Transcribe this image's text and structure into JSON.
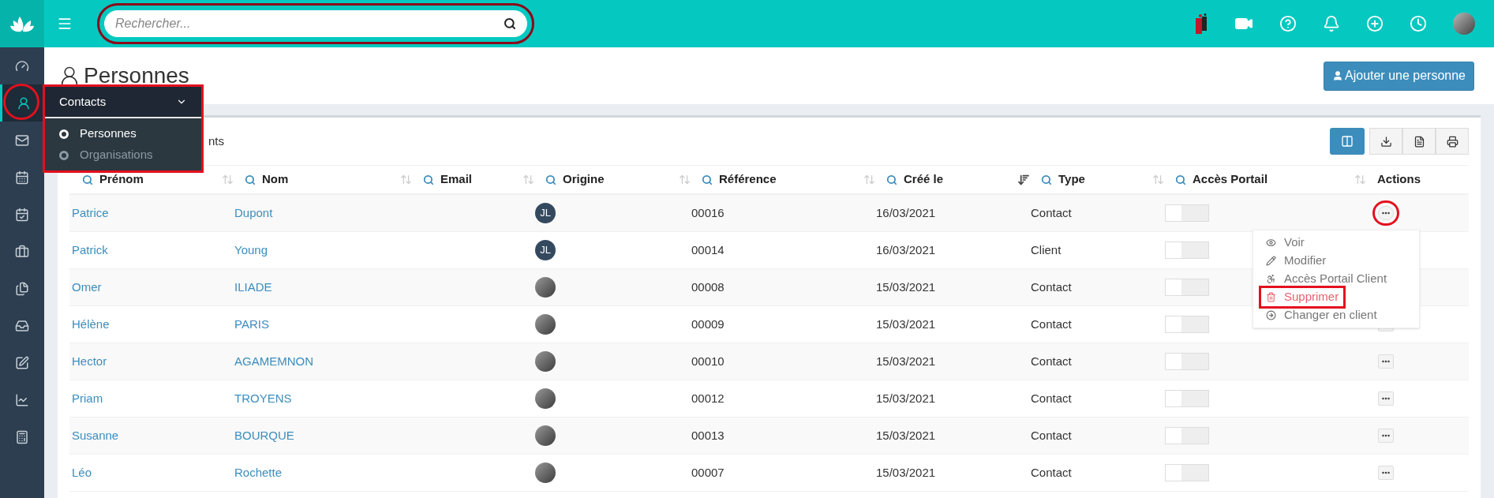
{
  "topbar": {
    "search": {
      "placeholder": "Rechercher..."
    }
  },
  "sidebar": {
    "items": [
      {
        "kind": "dashboard",
        "selected": false
      },
      {
        "kind": "contacts",
        "selected": true
      },
      {
        "kind": "mail",
        "selected": false
      },
      {
        "kind": "calendar",
        "selected": false
      },
      {
        "kind": "tasks",
        "selected": false
      },
      {
        "kind": "briefcase",
        "selected": false
      },
      {
        "kind": "documents",
        "selected": false
      },
      {
        "kind": "tray",
        "selected": false
      },
      {
        "kind": "edit",
        "selected": false
      },
      {
        "kind": "chart",
        "selected": false
      },
      {
        "kind": "calculator",
        "selected": false
      }
    ]
  },
  "flyout": {
    "title": "Contacts",
    "items": [
      {
        "label": "Personnes",
        "selected": true
      },
      {
        "label": "Organisations",
        "selected": false
      }
    ]
  },
  "page": {
    "title": "Personnes",
    "add_button": "Ajouter une personne",
    "toolbar_text": "nts"
  },
  "table": {
    "columns": [
      {
        "label": "Prénom",
        "search": true,
        "sortable": true,
        "sorted": false
      },
      {
        "label": "Nom",
        "search": true,
        "sortable": true,
        "sorted": false
      },
      {
        "label": "Email",
        "search": true,
        "sortable": true,
        "sorted": false
      },
      {
        "label": "Origine",
        "search": true,
        "sortable": true,
        "sorted": false
      },
      {
        "label": "Référence",
        "search": true,
        "sortable": true,
        "sorted": false
      },
      {
        "label": "Créé le",
        "search": true,
        "sortable": true,
        "sorted": true
      },
      {
        "label": "Type",
        "search": true,
        "sortable": true,
        "sorted": false
      },
      {
        "label": "Accès Portail",
        "search": true,
        "sortable": true,
        "sorted": false
      },
      {
        "label": "Actions"
      }
    ],
    "rows": [
      {
        "first_name": "Patrice",
        "last_name": "Dupont",
        "origin": {
          "kind": "initials",
          "text": "JL"
        },
        "reference": "00016",
        "created": "16/03/2021",
        "type": "Contact",
        "portal_on": false,
        "menu_open": true
      },
      {
        "first_name": "Patrick",
        "last_name": "Young",
        "origin": {
          "kind": "initials",
          "text": "JL"
        },
        "reference": "00014",
        "created": "16/03/2021",
        "type": "Client",
        "portal_on": false,
        "menu_open": false
      },
      {
        "first_name": "Omer",
        "last_name": "ILIADE",
        "origin": {
          "kind": "photo"
        },
        "reference": "00008",
        "created": "15/03/2021",
        "type": "Contact",
        "portal_on": false,
        "menu_open": false
      },
      {
        "first_name": "Hélène",
        "last_name": "PARIS",
        "origin": {
          "kind": "photo"
        },
        "reference": "00009",
        "created": "15/03/2021",
        "type": "Contact",
        "portal_on": false,
        "menu_open": false
      },
      {
        "first_name": "Hector",
        "last_name": "AGAMEMNON",
        "origin": {
          "kind": "photo"
        },
        "reference": "00010",
        "created": "15/03/2021",
        "type": "Contact",
        "portal_on": false,
        "menu_open": false
      },
      {
        "first_name": "Priam",
        "last_name": "TROYENS",
        "origin": {
          "kind": "photo"
        },
        "reference": "00012",
        "created": "15/03/2021",
        "type": "Contact",
        "portal_on": false,
        "menu_open": false
      },
      {
        "first_name": "Susanne",
        "last_name": "BOURQUE",
        "origin": {
          "kind": "photo"
        },
        "reference": "00013",
        "created": "15/03/2021",
        "type": "Contact",
        "portal_on": false,
        "menu_open": false
      },
      {
        "first_name": "Léo",
        "last_name": "Rochette",
        "origin": {
          "kind": "photo"
        },
        "reference": "00007",
        "created": "15/03/2021",
        "type": "Contact",
        "portal_on": false,
        "menu_open": false
      }
    ]
  },
  "row_menu": {
    "items": [
      {
        "kind": "view",
        "label": "Voir",
        "highlighted": false
      },
      {
        "kind": "edit",
        "label": "Modifier",
        "highlighted": false
      },
      {
        "kind": "portal",
        "label": "Accès Portail Client",
        "highlighted": false
      },
      {
        "kind": "delete",
        "label": "Supprimer",
        "highlighted": true
      },
      {
        "kind": "convert",
        "label": "Changer en client",
        "highlighted": false
      }
    ]
  }
}
